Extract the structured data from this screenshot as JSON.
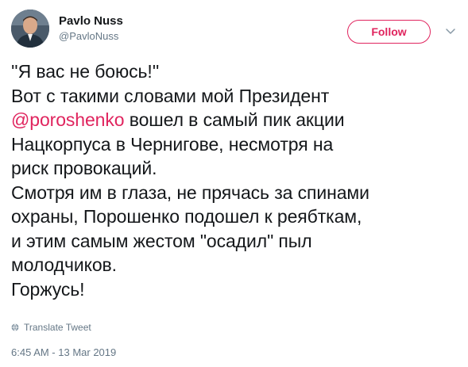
{
  "user": {
    "name": "Pavlo Nuss",
    "handle": "@PavloNuss"
  },
  "follow_button": {
    "label": "Follow"
  },
  "tweet": {
    "line1": "''Я вас не боюсь!''",
    "line2": "Вот с такими словами мой Президент",
    "mention": "@poroshenko",
    "line3_rest": " вошел в самый пик акции",
    "line4": "Нацкорпуса в Чернигове, несмотря на",
    "line5": "риск провокаций.",
    "line6": "Смотря им в глаза, не прячась за спинами",
    "line7": "охраны, Порошенко подошел к реябткам,",
    "line8": "и этим самым жестом \"осадил\" пыл",
    "line9": "молодчиков.",
    "line10": "Горжусь!"
  },
  "translate": {
    "label": "Translate Tweet",
    "icon": "globe-icon"
  },
  "timestamp": "6:45 AM - 13 Mar 2019",
  "colors": {
    "accent": "#e0245e",
    "text": "#14171a",
    "secondary": "#657786"
  }
}
